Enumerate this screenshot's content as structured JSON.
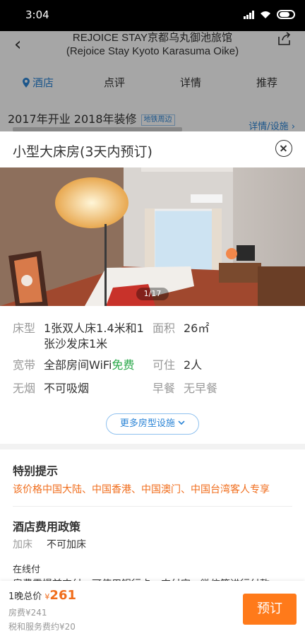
{
  "status_bar": {
    "time": "3:04"
  },
  "header": {
    "title_line1": "REJOICE STAY京都乌丸御池旅馆",
    "title_line2": "(Rejoice Stay  Kyoto Karasuma Oike)"
  },
  "tabs": [
    {
      "label": "酒店"
    },
    {
      "label": "点评"
    },
    {
      "label": "详情"
    },
    {
      "label": "推荐"
    }
  ],
  "hotel_info": {
    "opened": "2017年开业 2018年装修",
    "metro_badge": "地铁周边",
    "details_link": "详情/设施 ›"
  },
  "room_sheet": {
    "title": "小型大床房(3天内预订)",
    "photo_counter": "1/17",
    "attributes": {
      "bed_label": "床型",
      "bed_value_line1": "1张双人床1.4米和1",
      "bed_value_line2": "张沙发床1米",
      "area_label": "面积",
      "area_value": "26㎡",
      "broadband_label": "宽带",
      "broadband_value": "全部房间WiFi",
      "broadband_free": "免费",
      "occupancy_label": "可住",
      "occupancy_value": "2人",
      "smoking_label": "无烟",
      "smoking_value": "不可吸烟",
      "breakfast_label": "早餐",
      "breakfast_value": "无早餐"
    },
    "more_facilities": "更多房型设施",
    "special_notice_title": "特别提示",
    "special_notice_text": "该价格中国大陆、中国香港、中国澳门、中国台湾客人专享",
    "fee_policy_title": "酒店费用政策",
    "extra_bed_label": "加床",
    "extra_bed_value": "不可加床",
    "payment_title": "在线付",
    "payment_text": "房费需提前支付，可使用银行卡、支付宝、微信等进行付款"
  },
  "bottom_bar": {
    "total_label": "1晚总价",
    "currency": "¥",
    "total_price": "261",
    "room_fee": "房费¥241",
    "tax_fee": "税和服务费约¥20",
    "book_button": "预订"
  },
  "colors": {
    "accent_blue": "#2b84d6",
    "accent_orange": "#f06d1c",
    "book_button": "#ff7a1a",
    "free_green": "#2aa84a"
  }
}
